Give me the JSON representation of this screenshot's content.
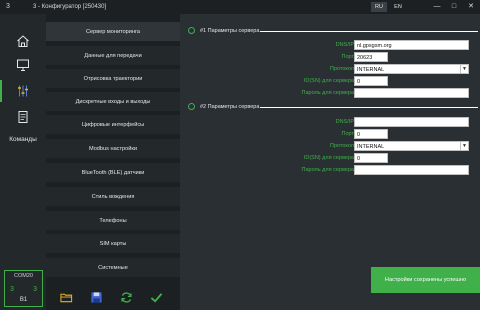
{
  "titlebar": {
    "app_icon": "3",
    "title": "3 - Конфигуратор [250430]",
    "lang_ru": "RU",
    "lang_en": "EN",
    "minimize": "—",
    "maximize": "□",
    "close": "✕"
  },
  "rail": {
    "items": [
      {
        "name": "home-icon"
      },
      {
        "name": "monitor-icon"
      },
      {
        "name": "sliders-icon"
      },
      {
        "name": "document-icon"
      }
    ],
    "label": "Команды"
  },
  "com": {
    "name": "COM20",
    "left": "3",
    "right": "3",
    "bottom": "B1"
  },
  "menu": {
    "items": [
      "Сервер мониторинга",
      "Данные для передачи",
      "Отрисовка траектории",
      "Дискретные входы и выходы",
      "Цифровые интерфейсы",
      "Modbus настройки",
      "BlueTooth (BLE) датчики",
      "Стиль вождения",
      "Телефоны",
      "SIM карты",
      "Системные"
    ],
    "active_index": 0,
    "toolbar": [
      {
        "name": "open-folder-icon",
        "color": "#e6b422"
      },
      {
        "name": "save-disk-icon",
        "color": "#3a66d6"
      },
      {
        "name": "refresh-icon",
        "color": "#3fb04a"
      },
      {
        "name": "check-icon",
        "color": "#3fb04a"
      }
    ]
  },
  "server1": {
    "title": "#1 Параметры сервера",
    "dns_label": "DNS/IP",
    "dns_value": "nl.gpsgsm.org",
    "port_label": "Порт",
    "port_value": "20623",
    "protocol_label": "Протокол",
    "protocol_value": "INTERNAL",
    "id_label": "ID(SN) для сервера",
    "id_value": "0",
    "pass_label": "Пароль для сервера",
    "pass_value": ""
  },
  "server2": {
    "title": "#2 Параметры сервера",
    "dns_label": "DNS/IP",
    "dns_value": "",
    "port_label": "Порт",
    "port_value": "0",
    "protocol_label": "Протокол",
    "protocol_value": "INTERNAL",
    "id_label": "ID(SN) для сервера",
    "id_value": "0",
    "pass_label": "Пароль для сервера",
    "pass_value": ""
  },
  "toast": {
    "message": "Настройки сохранены успешно"
  },
  "colors": {
    "accent": "#3fb04a",
    "bg_dark": "#1c2023",
    "bg_panel": "#23282b",
    "bg_content": "#2a2f33"
  }
}
